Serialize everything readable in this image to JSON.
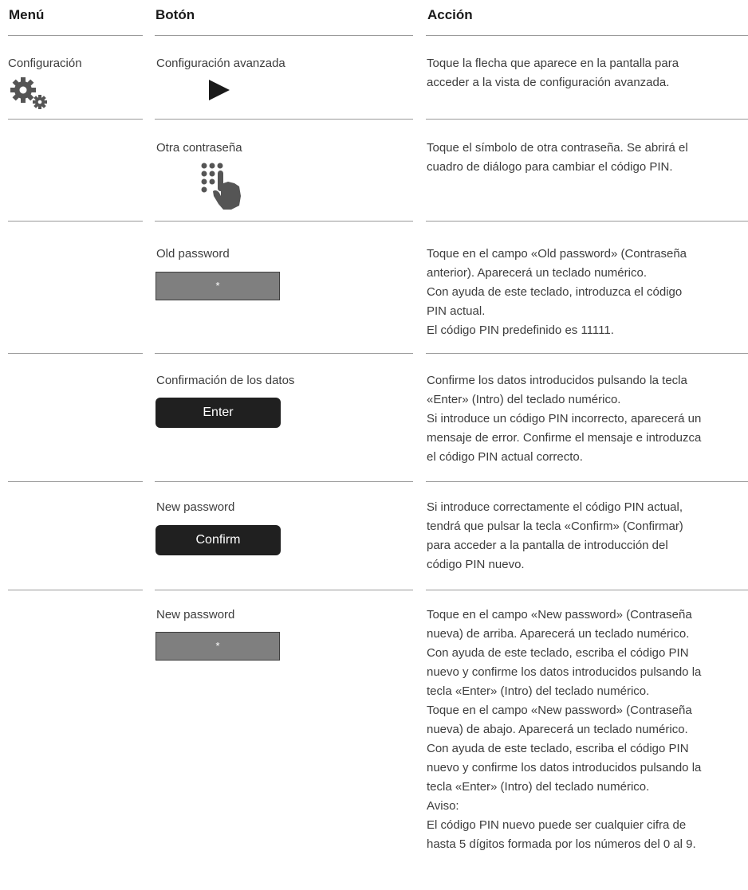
{
  "header": {
    "menu": "Menú",
    "button": "Botón",
    "action": "Acción"
  },
  "rows": [
    {
      "menu": "Configuración",
      "button": "Configuración avanzada",
      "icon": "gears-icon",
      "control_icon": "play-arrow-icon",
      "lines": [
        "Toque la flecha que aparece en la pantalla para",
        "acceder a la vista de configuración avanzada."
      ]
    },
    {
      "button": "Otra contraseña",
      "control_icon": "keypad-hand-icon",
      "lines": [
        "Toque el símbolo de otra contraseña. Se abrirá el",
        "cuadro de diálogo para cambiar el código PIN."
      ]
    },
    {
      "button": "Old password",
      "field_value": "*",
      "lines": [
        "Toque en el campo «Old password» (Contraseña",
        "anterior). Aparecerá un teclado numérico.",
        "Con ayuda de este teclado, introduzca el código",
        "PIN actual.",
        "El código PIN predefinido es 11111."
      ]
    },
    {
      "button": "Confirmación de los datos",
      "control_label": "Enter",
      "lines": [
        "Confirme los datos introducidos pulsando la tecla",
        "«Enter» (Intro) del teclado numérico.",
        "Si introduce un código PIN incorrecto, aparecerá un",
        "mensaje de error. Confirme el mensaje e introduzca",
        "el código PIN actual correcto."
      ]
    },
    {
      "button": "New password",
      "control_label": "Confirm",
      "lines": [
        "Si introduce correctamente el código PIN actual,",
        "tendrá que pulsar la tecla «Confirm» (Confirmar)",
        "para acceder a la pantalla de introducción del",
        "código PIN nuevo."
      ]
    },
    {
      "button": "New password",
      "field_value": "*",
      "lines": [
        "Toque en el campo «New password» (Contraseña",
        "nueva) de arriba. Aparecerá un teclado numérico.",
        "Con ayuda de este teclado, escriba el código PIN",
        "nuevo y confirme los datos introducidos pulsando la",
        "tecla «Enter» (Intro) del teclado numérico.",
        "Toque en el campo «New password» (Contraseña",
        "nueva) de abajo. Aparecerá un teclado numérico.",
        "Con ayuda de este teclado, escriba el código PIN",
        "nuevo y confirme los datos introducidos pulsando la",
        "tecla «Enter» (Intro) del teclado numérico.",
        "Aviso:",
        "El código PIN nuevo puede ser cualquier cifra de",
        "hasta 5 dígitos formada por los números del 0 al 9."
      ]
    }
  ]
}
